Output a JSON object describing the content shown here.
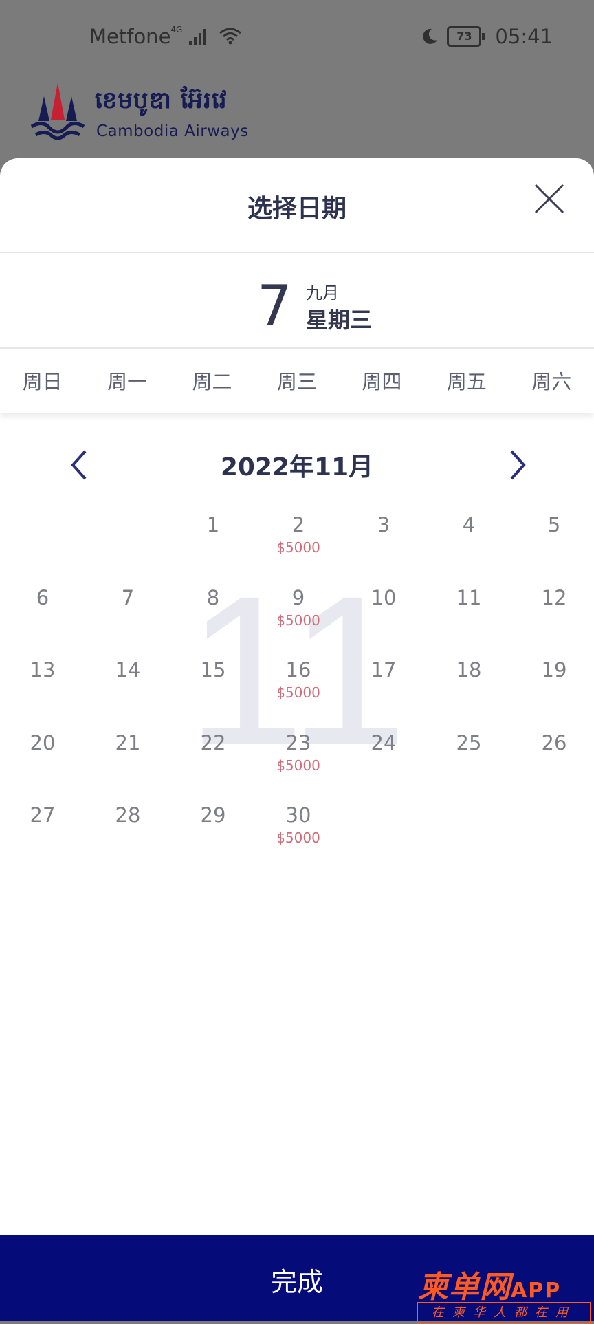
{
  "status_bar": {
    "carrier": "Metfone",
    "network": "4G",
    "battery": "73",
    "time": "05:41"
  },
  "logo": {
    "khmer": "ខេមបូឌា អ៊ែរវេ",
    "english": "Cambodia Airways"
  },
  "sheet": {
    "title": "选择日期",
    "selected": {
      "day": "7",
      "month": "九月",
      "weekday": "星期三"
    },
    "weekdays": [
      "周日",
      "周一",
      "周二",
      "周三",
      "周四",
      "周五",
      "周六"
    ],
    "month_title": "2022年11月",
    "watermark": "11",
    "days": [
      {
        "num": "1",
        "price": ""
      },
      {
        "num": "2",
        "price": "$5000"
      },
      {
        "num": "3",
        "price": ""
      },
      {
        "num": "4",
        "price": ""
      },
      {
        "num": "5",
        "price": ""
      },
      {
        "num": "6",
        "price": ""
      },
      {
        "num": "7",
        "price": ""
      },
      {
        "num": "8",
        "price": ""
      },
      {
        "num": "9",
        "price": "$5000"
      },
      {
        "num": "10",
        "price": ""
      },
      {
        "num": "11",
        "price": ""
      },
      {
        "num": "12",
        "price": ""
      },
      {
        "num": "13",
        "price": ""
      },
      {
        "num": "14",
        "price": ""
      },
      {
        "num": "15",
        "price": ""
      },
      {
        "num": "16",
        "price": "$5000"
      },
      {
        "num": "17",
        "price": ""
      },
      {
        "num": "18",
        "price": ""
      },
      {
        "num": "19",
        "price": ""
      },
      {
        "num": "20",
        "price": ""
      },
      {
        "num": "21",
        "price": ""
      },
      {
        "num": "22",
        "price": ""
      },
      {
        "num": "23",
        "price": "$5000"
      },
      {
        "num": "24",
        "price": ""
      },
      {
        "num": "25",
        "price": ""
      },
      {
        "num": "26",
        "price": ""
      },
      {
        "num": "27",
        "price": ""
      },
      {
        "num": "28",
        "price": ""
      },
      {
        "num": "29",
        "price": ""
      },
      {
        "num": "30",
        "price": "$5000"
      }
    ],
    "done_label": "完成"
  },
  "watermark_brand": {
    "main": "柬单网",
    "app": "APP",
    "sub": "在柬华人都在用"
  },
  "colors": {
    "accent": "#050c7a",
    "price": "#d16b78",
    "brand": "#ff5a1f"
  }
}
